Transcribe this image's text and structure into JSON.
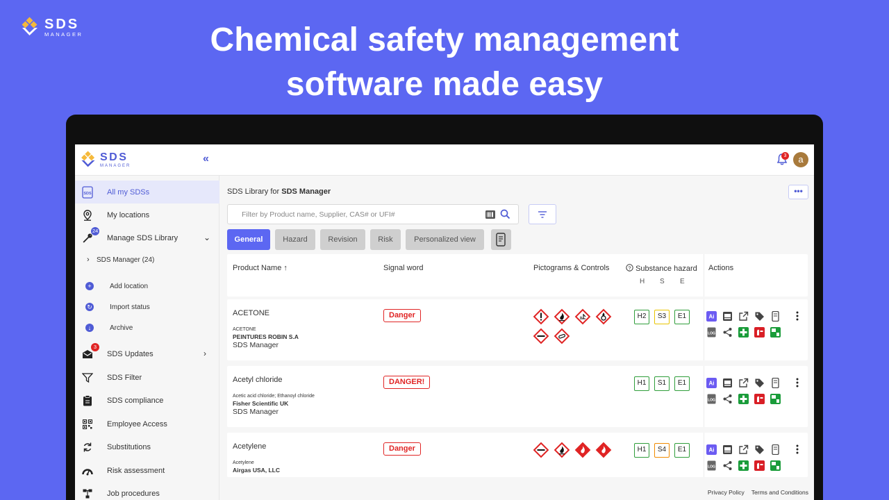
{
  "brand": {
    "name": "SDS",
    "sub": "MANAGER"
  },
  "headline": {
    "line1": "Chemical safety management",
    "line2": "software made easy"
  },
  "topbar": {
    "collapse": "«",
    "notifications": "3",
    "avatar": "a"
  },
  "sidebar": {
    "items": [
      {
        "label": "All my SDSs"
      },
      {
        "label": "My locations"
      },
      {
        "label": "Manage SDS Library",
        "badge": "24"
      },
      {
        "label": "SDS Updates",
        "badge": "3"
      },
      {
        "label": "SDS Filter"
      },
      {
        "label": "SDS compliance"
      },
      {
        "label": "Employee Access"
      },
      {
        "label": "Substitutions"
      },
      {
        "label": "Risk assessment"
      },
      {
        "label": "Job procedures"
      }
    ],
    "library_node": "SDS Manager (24)",
    "sub_items": [
      {
        "label": "Add location"
      },
      {
        "label": "Import status"
      },
      {
        "label": "Archive"
      }
    ]
  },
  "main": {
    "title_prefix": "SDS Library for ",
    "title_bold": "SDS Manager",
    "more": "•••",
    "search_placeholder": "Filter by Product name, Supplier, CAS# or UFI#",
    "tabs": [
      "General",
      "Hazard",
      "Revision",
      "Risk",
      "Personalized view"
    ],
    "columns": {
      "product": "Product Name",
      "sort_arrow": "↑",
      "signal": "Signal word",
      "pictograms": "Pictograms & Controls",
      "substance": "Substance hazard",
      "h": "H",
      "s": "S",
      "e": "E",
      "actions": "Actions"
    },
    "rows": [
      {
        "product": "ACETONE",
        "synonym": "ACETONE",
        "supplier": "PEINTURES ROBIN S.A",
        "library": "SDS Manager",
        "signal": "Danger",
        "h": "H2",
        "s": "S3",
        "e": "E1"
      },
      {
        "product": "Acetyl chloride",
        "synonym": "Acetic acid chloride; Ethanoyl chloride",
        "supplier": "Fisher Scientific UK",
        "library": "SDS Manager",
        "signal": "DANGER!",
        "h": "H1",
        "s": "S1",
        "e": "E1"
      },
      {
        "product": "Acetylene",
        "synonym": "Acetylene",
        "supplier": "Airgas USA, LLC",
        "library": "",
        "signal": "Danger",
        "h": "H1",
        "s": "S4",
        "e": "E1"
      }
    ]
  },
  "footer": {
    "privacy": "Privacy Policy",
    "terms": "Terms and Conditions"
  },
  "colors": {
    "bg": "#5c67f2",
    "accent": "#4f5bd5",
    "danger": "#e02424",
    "green": "#2f9d3a"
  }
}
